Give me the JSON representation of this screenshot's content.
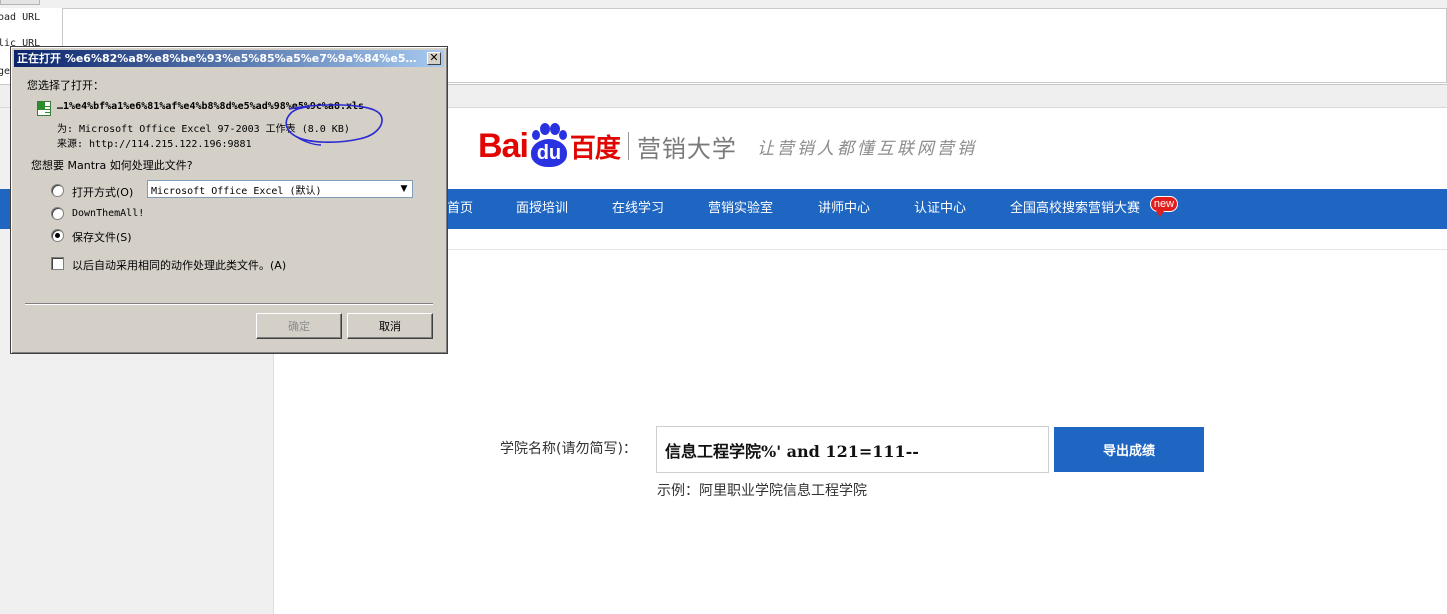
{
  "background": {
    "left_labels": [
      "oad URL",
      "lic URL",
      "ge"
    ]
  },
  "logo": {
    "bai": "Bai",
    "du": "du",
    "baidu_cn": "百度",
    "school": "营销大学",
    "slogan": "让营销人都懂互联网营销"
  },
  "nav": {
    "items": [
      {
        "label": "首页"
      },
      {
        "label": "面授培训"
      },
      {
        "label": "在线学习"
      },
      {
        "label": "营销实验室"
      },
      {
        "label": "讲师中心"
      },
      {
        "label": "认证中心"
      },
      {
        "label": "全国高校搜索营销大赛"
      }
    ],
    "badge": "new"
  },
  "form": {
    "label": "学院名称(请勿简写)：",
    "input_value": "信息工程学院%' and 121=111--",
    "export_button": "导出成绩",
    "example": "示例：阿里职业学院信息工程学院"
  },
  "dialog": {
    "title": "正在打开 %e6%82%a8%e8%be%93%e5%85%a5%e7%9a%84%e5%ad%a6%e...",
    "close": "✕",
    "chosen_label": "您选择了打开：",
    "filename": "…1%e4%bf%a1%e6%81%af%e4%b8%8d%e5%ad%98%e5%9c%a8.xls",
    "type_line": "为:  Microsoft Office Excel 97-2003 工作表 (8.0 KB)",
    "source_line": "来源:  http://114.215.122.196:9881",
    "question": "您想要 Mantra 如何处理此文件?",
    "open_with_label": "打开方式(O)",
    "open_with_value": "Microsoft Office Excel (默认)",
    "downthemall_label": "DownThemAll!",
    "save_label": "保存文件(S)",
    "auto_label": "以后自动采用相同的动作处理此类文件。(A)",
    "ok": "确定",
    "cancel": "取消",
    "selected_option": "save",
    "icons": {
      "file": "excel-file-icon",
      "dropdown": "chevron-down-icon",
      "close": "close-icon"
    },
    "colors": {
      "title_bar": "#0a246a",
      "face": "#d4d0c8",
      "annotation": "#2a2ad0"
    }
  },
  "colors": {
    "nav_bg": "#1f66c2",
    "baidu_red": "#e10602",
    "baidu_blue": "#2932e1",
    "badge": "#e21d1d"
  }
}
